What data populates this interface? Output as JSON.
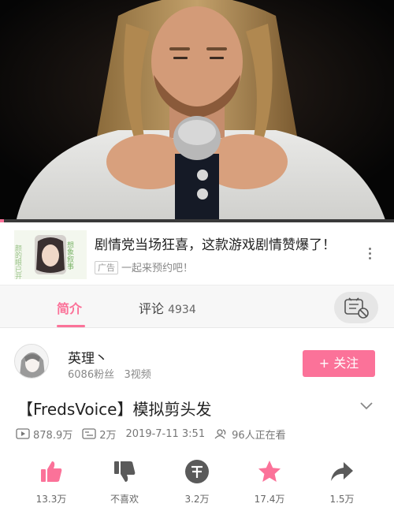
{
  "video": {
    "progress": 0.01
  },
  "ad": {
    "title": "剧情党当场狂喜，这款游戏剧情赞爆了！",
    "badge": "广告",
    "subtitle": "一起来预约吧！",
    "thumb_text": [
      "想象叙事",
      "颜的眼已开启"
    ]
  },
  "tabs": {
    "intro": "简介",
    "comments": "评论",
    "comments_count": "4934"
  },
  "uploader": {
    "name": "英理丶",
    "fans": "6086粉丝",
    "videos": "3视频",
    "follow_label": "+ 关注"
  },
  "video_info": {
    "title": "【FredsVoice】模拟剪头发",
    "views": "878.9万",
    "danmaku": "2万",
    "datetime": "2019-7-11 3:51",
    "watching": "96人正在看"
  },
  "actions": {
    "like": "13.3万",
    "dislike": "不喜欢",
    "coin": "3.2万",
    "favorite": "17.4万",
    "share": "1.5万"
  },
  "colors": {
    "accent": "#fb7299"
  }
}
